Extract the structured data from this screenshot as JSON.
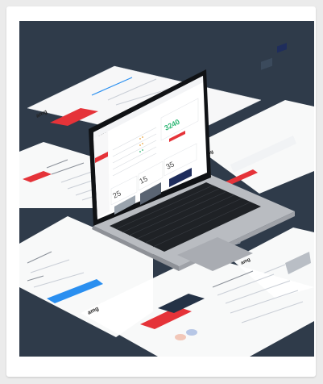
{
  "image": {
    "kind": "isometric laptop mockup",
    "background_color": "#2f3b4a",
    "accent_color": "#e53339",
    "blue_button_color": "#2a8ff0"
  },
  "laptop_screen": {
    "brand": "amg",
    "big_number": "3240",
    "stats": [
      "25",
      "15",
      "35"
    ]
  },
  "left_panels": {
    "brand": "amg"
  },
  "right_panels": {
    "brand": "amg"
  },
  "bottom_panel": {
    "brand": "amg"
  }
}
